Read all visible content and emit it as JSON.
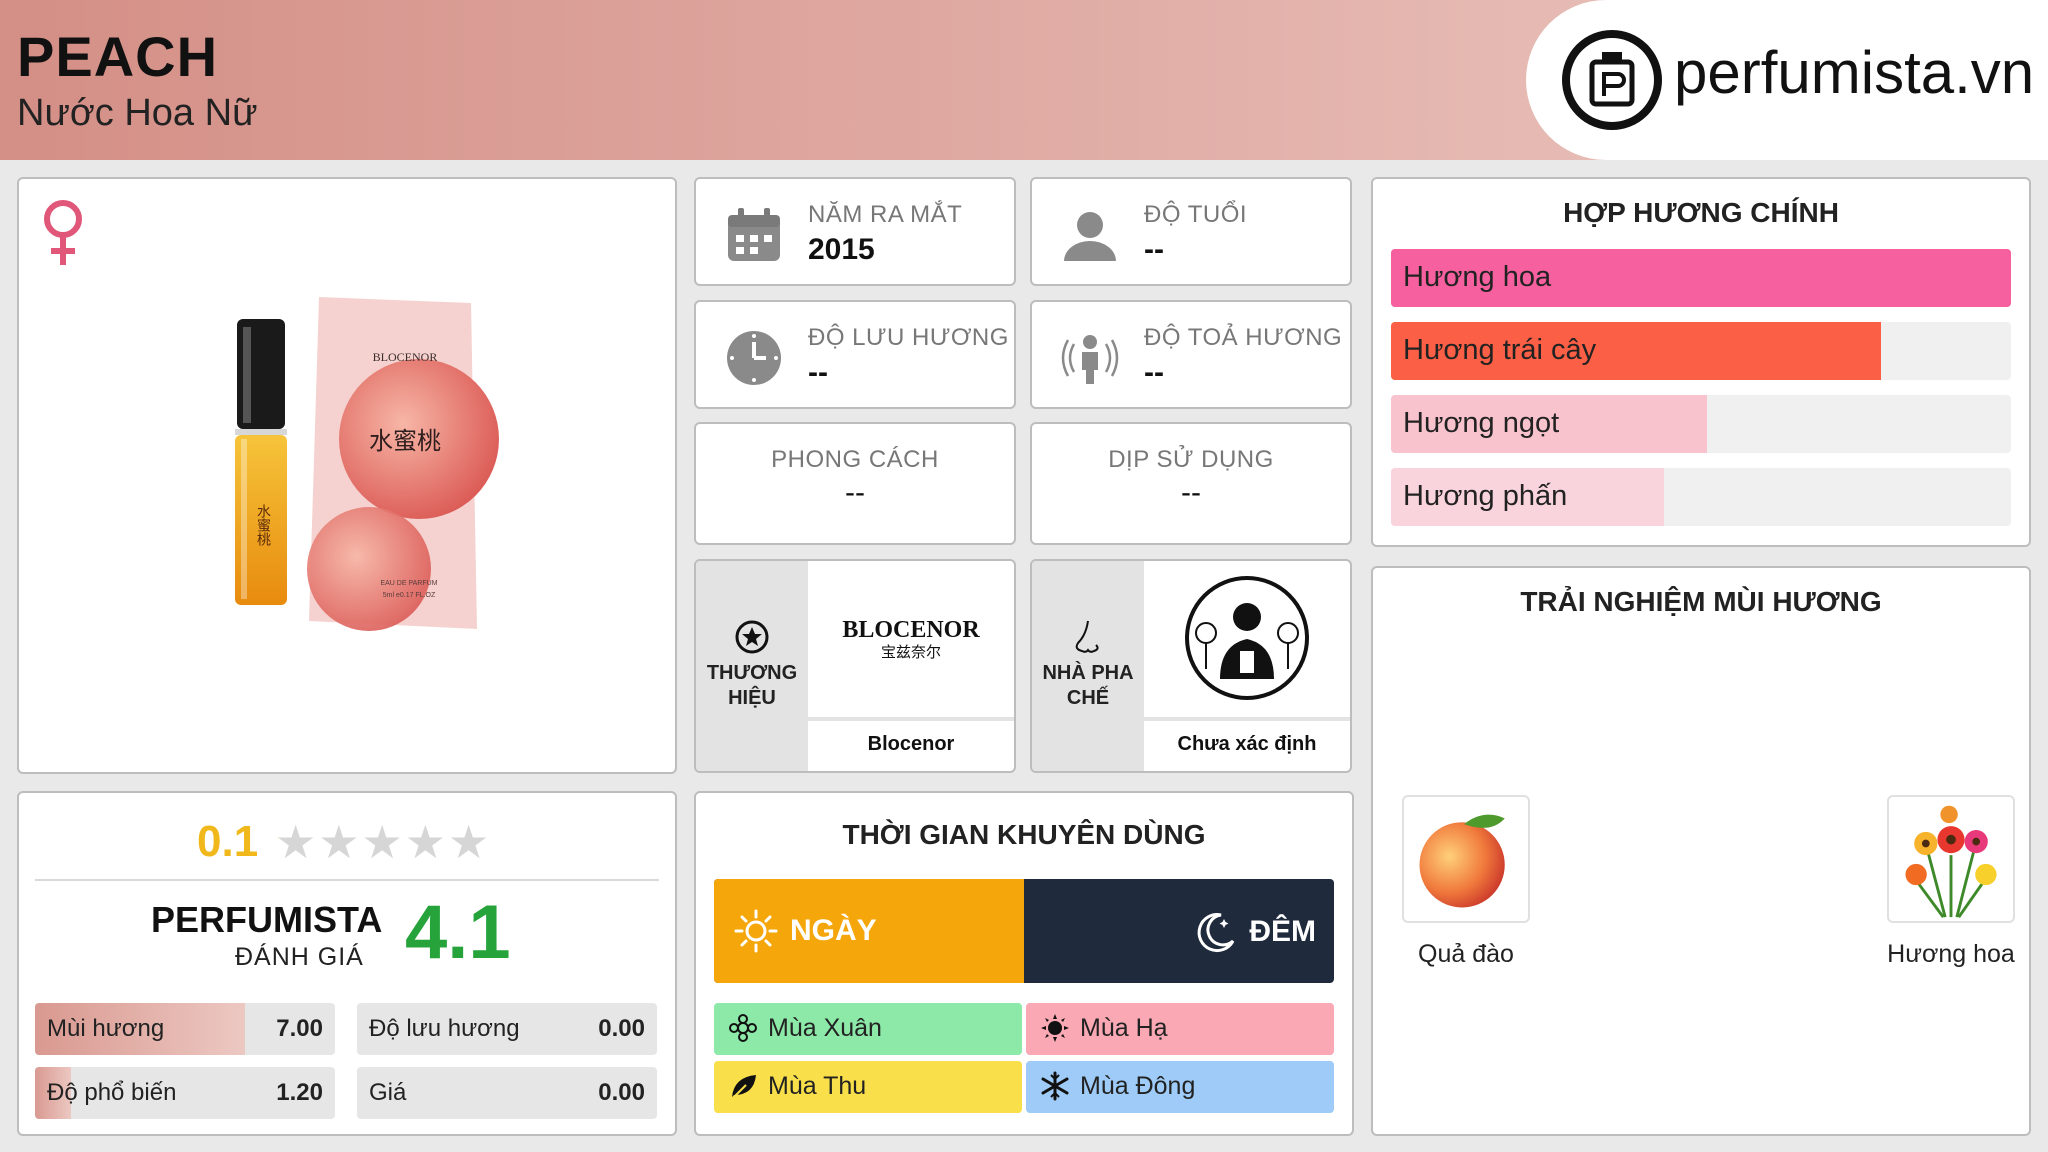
{
  "header": {
    "name": "PEACH",
    "subtitle": "Nước Hoa Nữ",
    "logo_text": "perfumista.vn"
  },
  "info": {
    "year_label": "NĂM RA MẮT",
    "year_value": "2015",
    "age_label": "ĐỘ TUỔI",
    "age_value": "--",
    "longevity_label": "ĐỘ LƯU HƯƠNG",
    "longevity_value": "--",
    "sillage_label": "ĐỘ TOẢ HƯƠNG",
    "sillage_value": "--",
    "style_label": "PHONG CÁCH",
    "style_value": "--",
    "occasion_label": "DỊP SỬ DỤNG",
    "occasion_value": "--"
  },
  "brand": {
    "label": "THƯƠNG HIỆU",
    "name": "Blocenor",
    "logo_text": "BLOCENOR",
    "logo_sub": "宝兹奈尔"
  },
  "perfumer": {
    "label": "NHÀ PHA CHẾ",
    "name": "Chưa xác định"
  },
  "product_image": {
    "box_brand": "BLOCENOR",
    "box_cn": "水蜜桃",
    "box_edp": "EAU DE PARFUM",
    "box_size": "5ml e0.17 FL.OZ",
    "bottle_cn": "水蜜桃"
  },
  "main_notes": {
    "title": "HỢP HƯƠNG CHÍNH",
    "items": [
      {
        "label": "Hương hoa",
        "level": 1.0,
        "color": "#f7609f"
      },
      {
        "label": "Hương trái cây",
        "level": 0.79,
        "color": "#fb5f45"
      },
      {
        "label": "Hương ngọt",
        "level": 0.51,
        "color": "#f9c3cd"
      },
      {
        "label": "Hương phấn",
        "level": 0.44,
        "color": "#f9d4dc"
      }
    ]
  },
  "rating": {
    "user_score": "0.1",
    "stars_filled": 0.02,
    "stars": "★★★★★",
    "pf_title": "PERFUMISTA",
    "pf_sub": "ĐÁNH GIÁ",
    "pf_score": "4.1",
    "metrics": [
      {
        "label": "Mùi hương",
        "value": "7.00",
        "level": 0.7
      },
      {
        "label": "Độ lưu hương",
        "value": "0.00",
        "level": 0.0
      },
      {
        "label": "Độ phổ biến",
        "value": "1.20",
        "level": 0.12
      },
      {
        "label": "Giá",
        "value": "0.00",
        "level": 0.0
      }
    ]
  },
  "time": {
    "title": "THỜI GIAN KHUYÊN DÙNG",
    "day_label": "NGÀY",
    "night_label": "ĐÊM",
    "day_level": 0.5,
    "seasons": [
      {
        "label": "Mùa Xuân",
        "color": "#8de9a8",
        "icon": "flower-icon"
      },
      {
        "label": "Mùa Hạ",
        "color": "#f9a8b4",
        "icon": "sun-icon"
      },
      {
        "label": "Mùa Thu",
        "color": "#f9e04a",
        "icon": "leaf-icon"
      },
      {
        "label": "Mùa Đông",
        "color": "#9ecbf7",
        "icon": "snowflake-icon"
      }
    ]
  },
  "experience": {
    "title": "TRẢI NGHIỆM MÙI HƯƠNG",
    "items": [
      {
        "label": "Quả đào",
        "icon": "peach-icon"
      },
      {
        "label": "Hương hoa",
        "icon": "flowers-icon"
      }
    ]
  }
}
